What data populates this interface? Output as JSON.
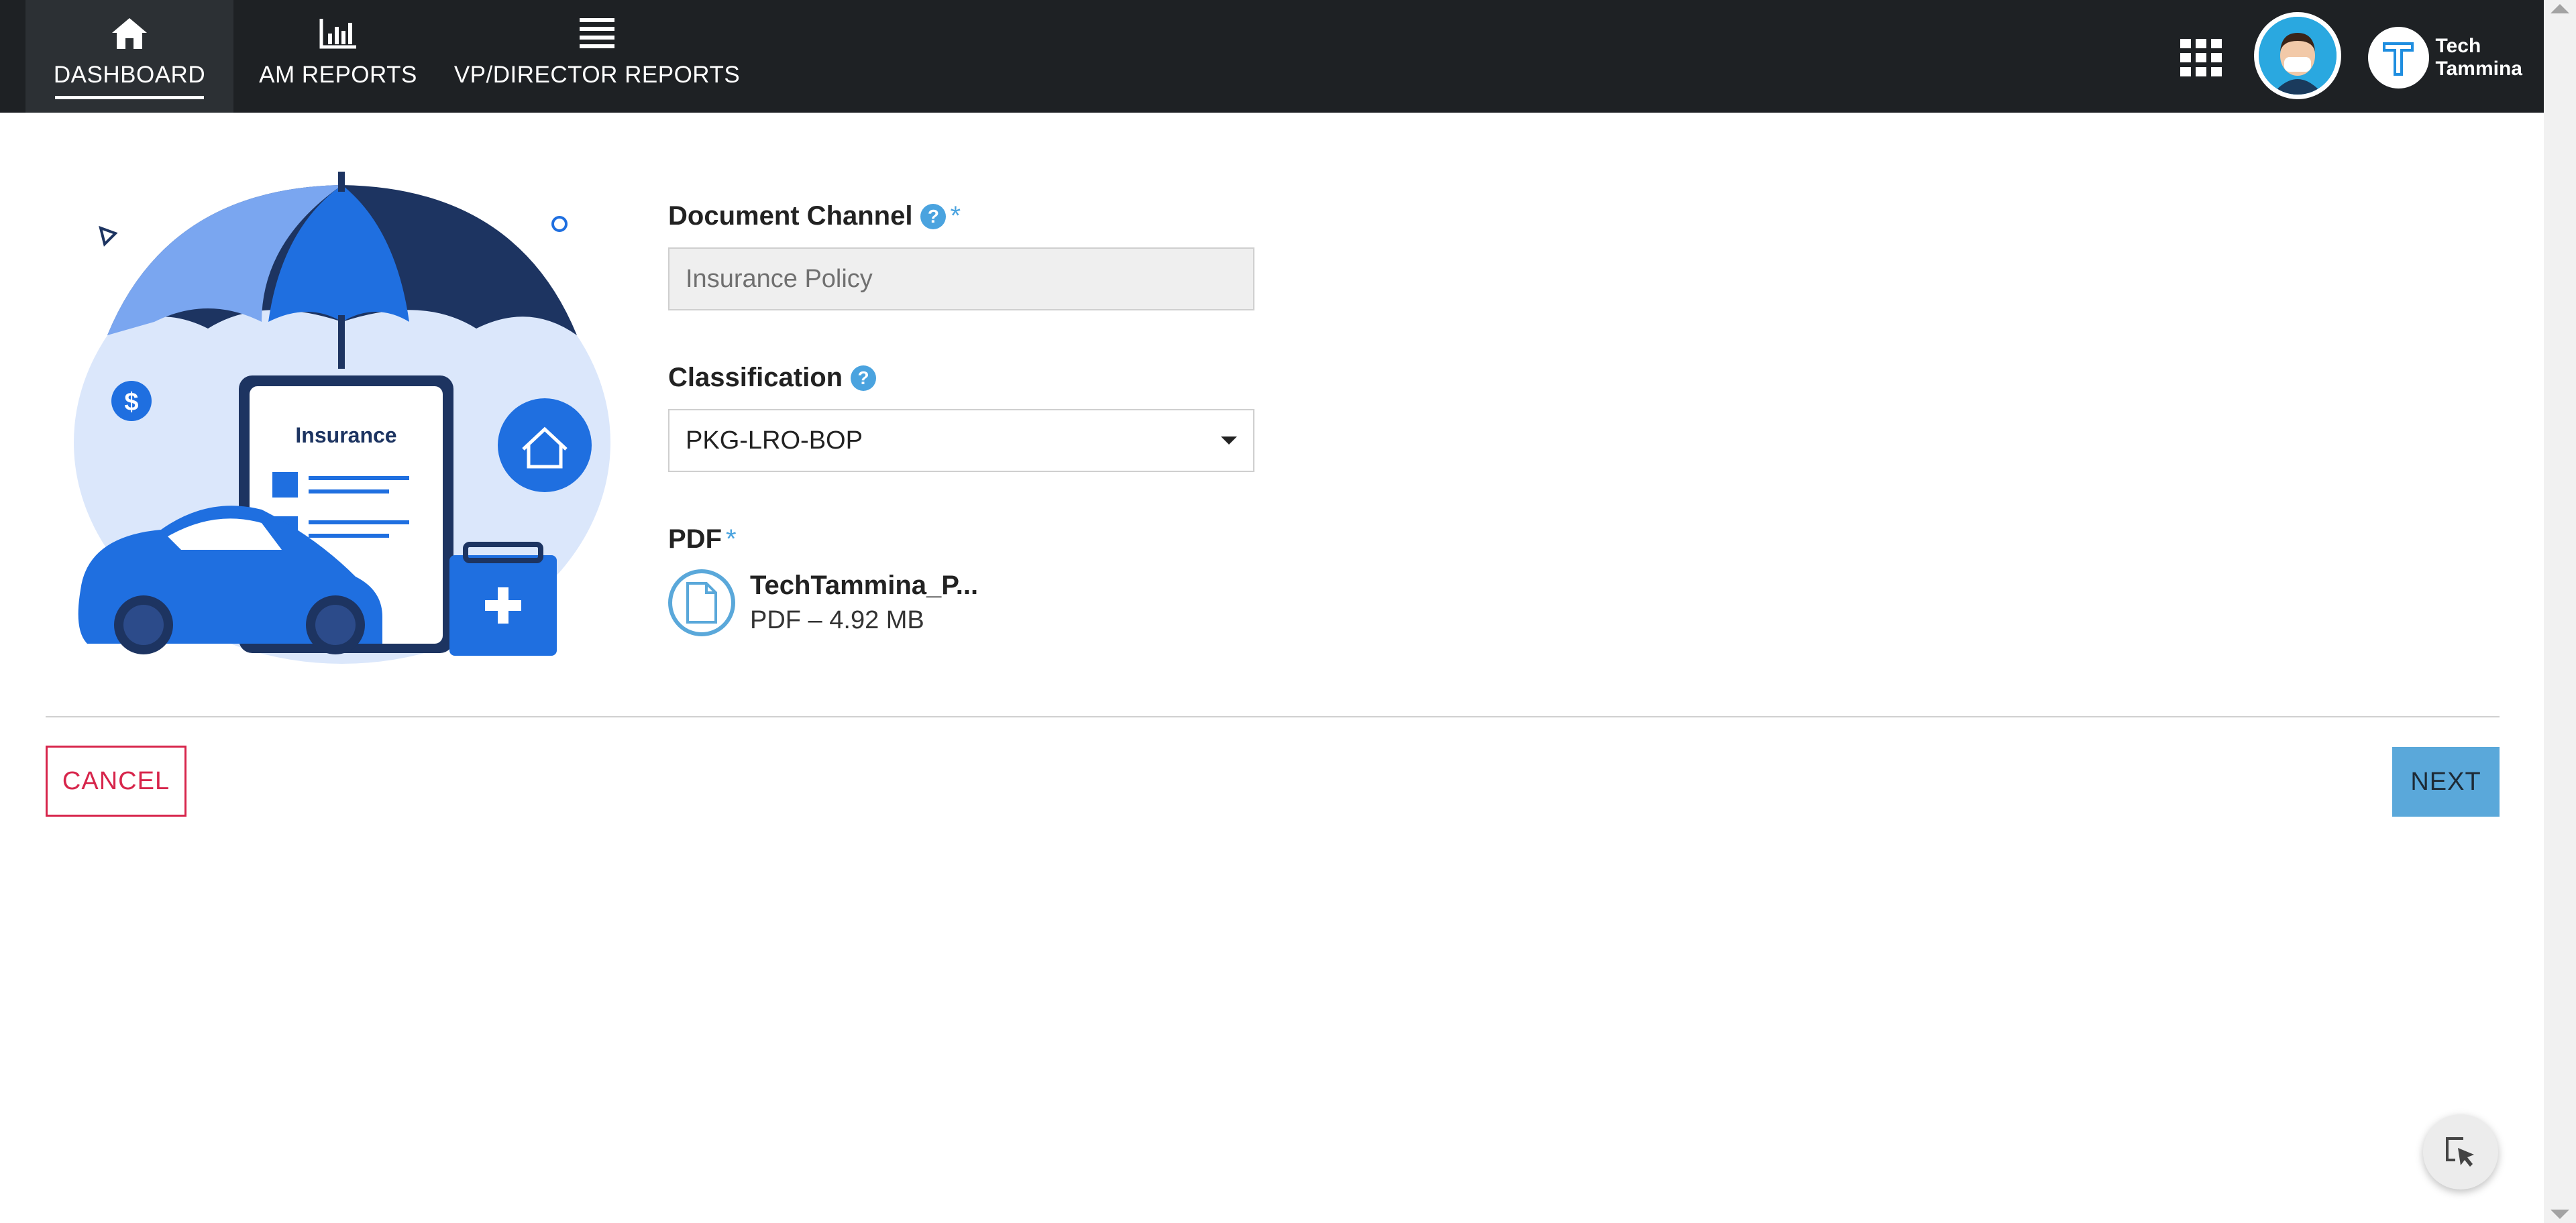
{
  "nav": {
    "items": [
      {
        "label": "DASHBOARD",
        "icon": "home-icon",
        "active": true
      },
      {
        "label": "AM REPORTS",
        "icon": "bar-chart-icon",
        "active": false
      },
      {
        "label": "VP/DIRECTOR REPORTS",
        "icon": "list-icon",
        "active": false
      }
    ],
    "right_icons": [
      "apps-grid-icon",
      "user-avatar",
      "tech-tammina-logo"
    ],
    "brand": {
      "line1": "Tech",
      "line2": "Tammina"
    }
  },
  "illustration": {
    "card_title": "Insurance"
  },
  "form": {
    "document_channel": {
      "label": "Document Channel",
      "required": "*",
      "value": "Insurance Policy"
    },
    "classification": {
      "label": "Classification",
      "selected": "PKG-LRO-BOP"
    },
    "pdf": {
      "label": "PDF",
      "required": "*",
      "file_name": "TechTammina_P...",
      "file_meta": "PDF – 4.92 MB"
    }
  },
  "actions": {
    "cancel_label": "CANCEL",
    "next_label": "NEXT"
  },
  "colors": {
    "topbar": "#1e2124",
    "accent_blue": "#5aa8da",
    "cancel_red": "#d7254b",
    "help_blue": "#4aa3df"
  }
}
